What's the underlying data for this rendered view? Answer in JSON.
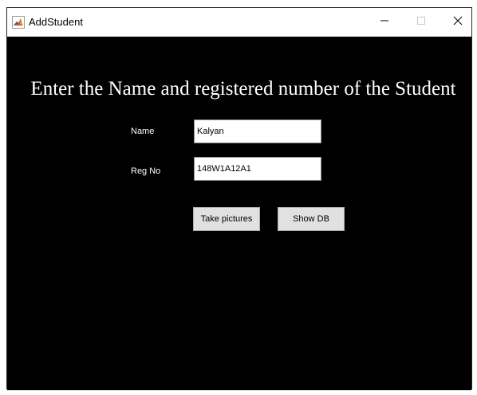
{
  "window": {
    "title": "AddStudent",
    "app_icon": "matlab-icon",
    "controls": {
      "minimize_icon": "minimize-icon",
      "maximize_icon": "maximize-icon",
      "close_icon": "close-icon"
    }
  },
  "form": {
    "heading": "Enter the Name and registered number of the Student",
    "name_label": "Name",
    "name_value": "Kalyan",
    "reg_label": "Reg No",
    "reg_value": "148W1A12A1",
    "take_pictures_label": "Take pictures",
    "show_db_label": "Show DB"
  },
  "colors": {
    "background": "#000000",
    "text": "#ffffff",
    "button_face": "#e1e1e1"
  }
}
